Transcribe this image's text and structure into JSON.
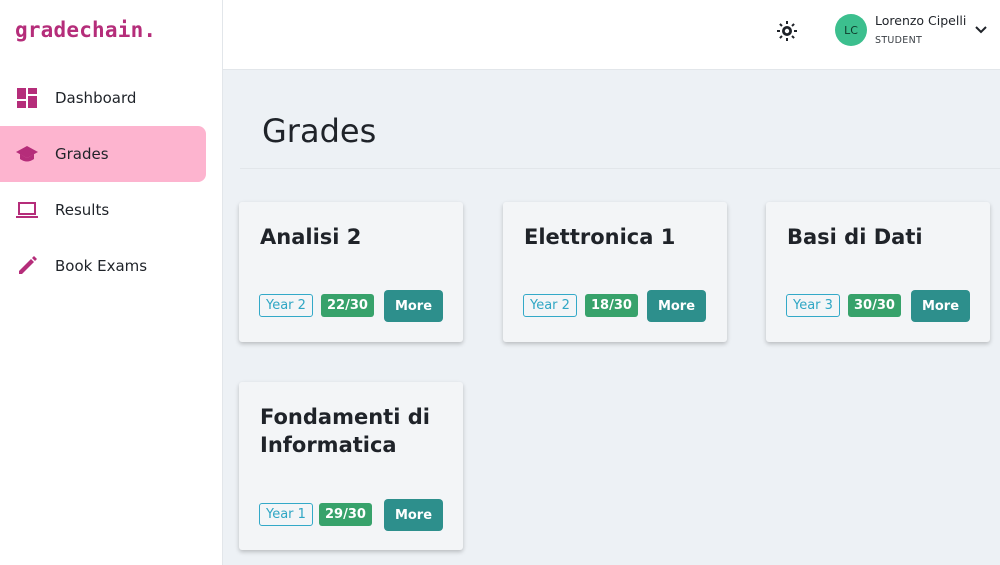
{
  "brand": "gradechain.",
  "sidebar": {
    "items": [
      {
        "label": "Dashboard",
        "icon": "dashboard-icon"
      },
      {
        "label": "Grades",
        "icon": "graduation-cap-icon",
        "active": true
      },
      {
        "label": "Results",
        "icon": "laptop-icon"
      },
      {
        "label": "Book Exams",
        "icon": "pencil-icon"
      }
    ]
  },
  "header": {
    "theme_icon": "brightness-icon",
    "user": {
      "initials": "LC",
      "name": "Lorenzo Cipelli",
      "role": "STUDENT"
    }
  },
  "main": {
    "title": "Grades",
    "cards": [
      {
        "title_lines": [
          "Analisi 2"
        ],
        "year": "Year 2",
        "grade": "22/30",
        "more": "More"
      },
      {
        "title_lines": [
          "Elettronica 1"
        ],
        "year": "Year 2",
        "grade": "18/30",
        "more": "More"
      },
      {
        "title_lines": [
          "Basi di Dati"
        ],
        "year": "Year 3",
        "grade": "30/30",
        "more": "More"
      },
      {
        "title_lines": [
          "Fondamenti di",
          "Informatica"
        ],
        "year": "Year 1",
        "grade": "29/30",
        "more": "More"
      }
    ]
  },
  "colors": {
    "brand": "#b52d7a",
    "active_nav": "#fdb4cf",
    "avatar": "#3cbf8e",
    "year_badge": "#33a9c8",
    "grade_badge": "#37a26b",
    "more_button": "#2d8f8c",
    "background": "#edf1f5"
  }
}
